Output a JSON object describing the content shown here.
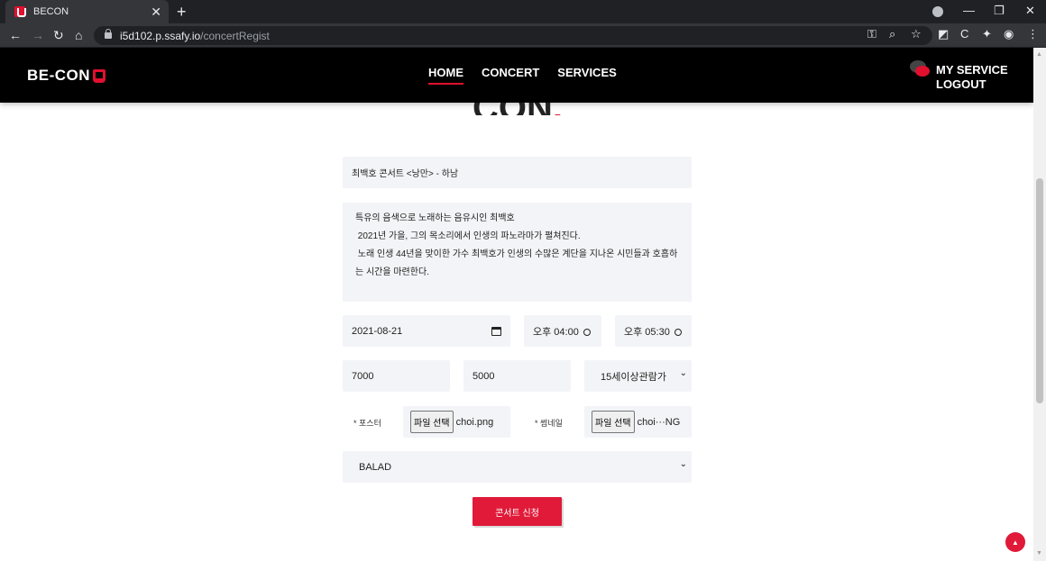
{
  "browser": {
    "tab_title": "BECON",
    "url_host": "i5d102.p.ssafy.io",
    "url_path": "/concertRegist"
  },
  "header": {
    "logo": "BE-CON",
    "menu": [
      {
        "label": "HOME",
        "active": true
      },
      {
        "label": "CONCERT",
        "active": false
      },
      {
        "label": "SERVICES",
        "active": false
      }
    ],
    "my_service": "MY SERVICE",
    "logout": "LOGOUT"
  },
  "page": {
    "partial_title": "CON",
    "partial_title_dot": "."
  },
  "form": {
    "title_value": "최백호 콘서트 <낭만> - 하남",
    "description_lines": [
      "특유의 음색으로 노래하는 음유시인 최백호",
      " 2021년 가을, 그의 목소리에서 인생의 파노라마가 펼쳐진다.",
      " 노래 인생 44년을 맞이한 가수 최백호가 인생의 수많은 계단을 지나온 시민들과 호흡하",
      "는 시간을 마련한다."
    ],
    "date_value": "2021-08-21",
    "start_time": "오후 04:00",
    "end_time": "오후 05:30",
    "price_value": "7000",
    "seats_value": "5000",
    "age_rating": "15세이상관람가",
    "poster_label": "* 포스터",
    "poster_button": "파일 선택",
    "poster_file": "choi.png",
    "thumbnail_label": "* 썸네일",
    "thumbnail_button": "파일 선택",
    "thumbnail_file": "choi···NG",
    "genre": "BALAD",
    "submit_label": "콘서트 신청"
  },
  "colors": {
    "accent": "#e01a38",
    "header_bg": "#000000",
    "field_bg": "#f3f4f7"
  }
}
